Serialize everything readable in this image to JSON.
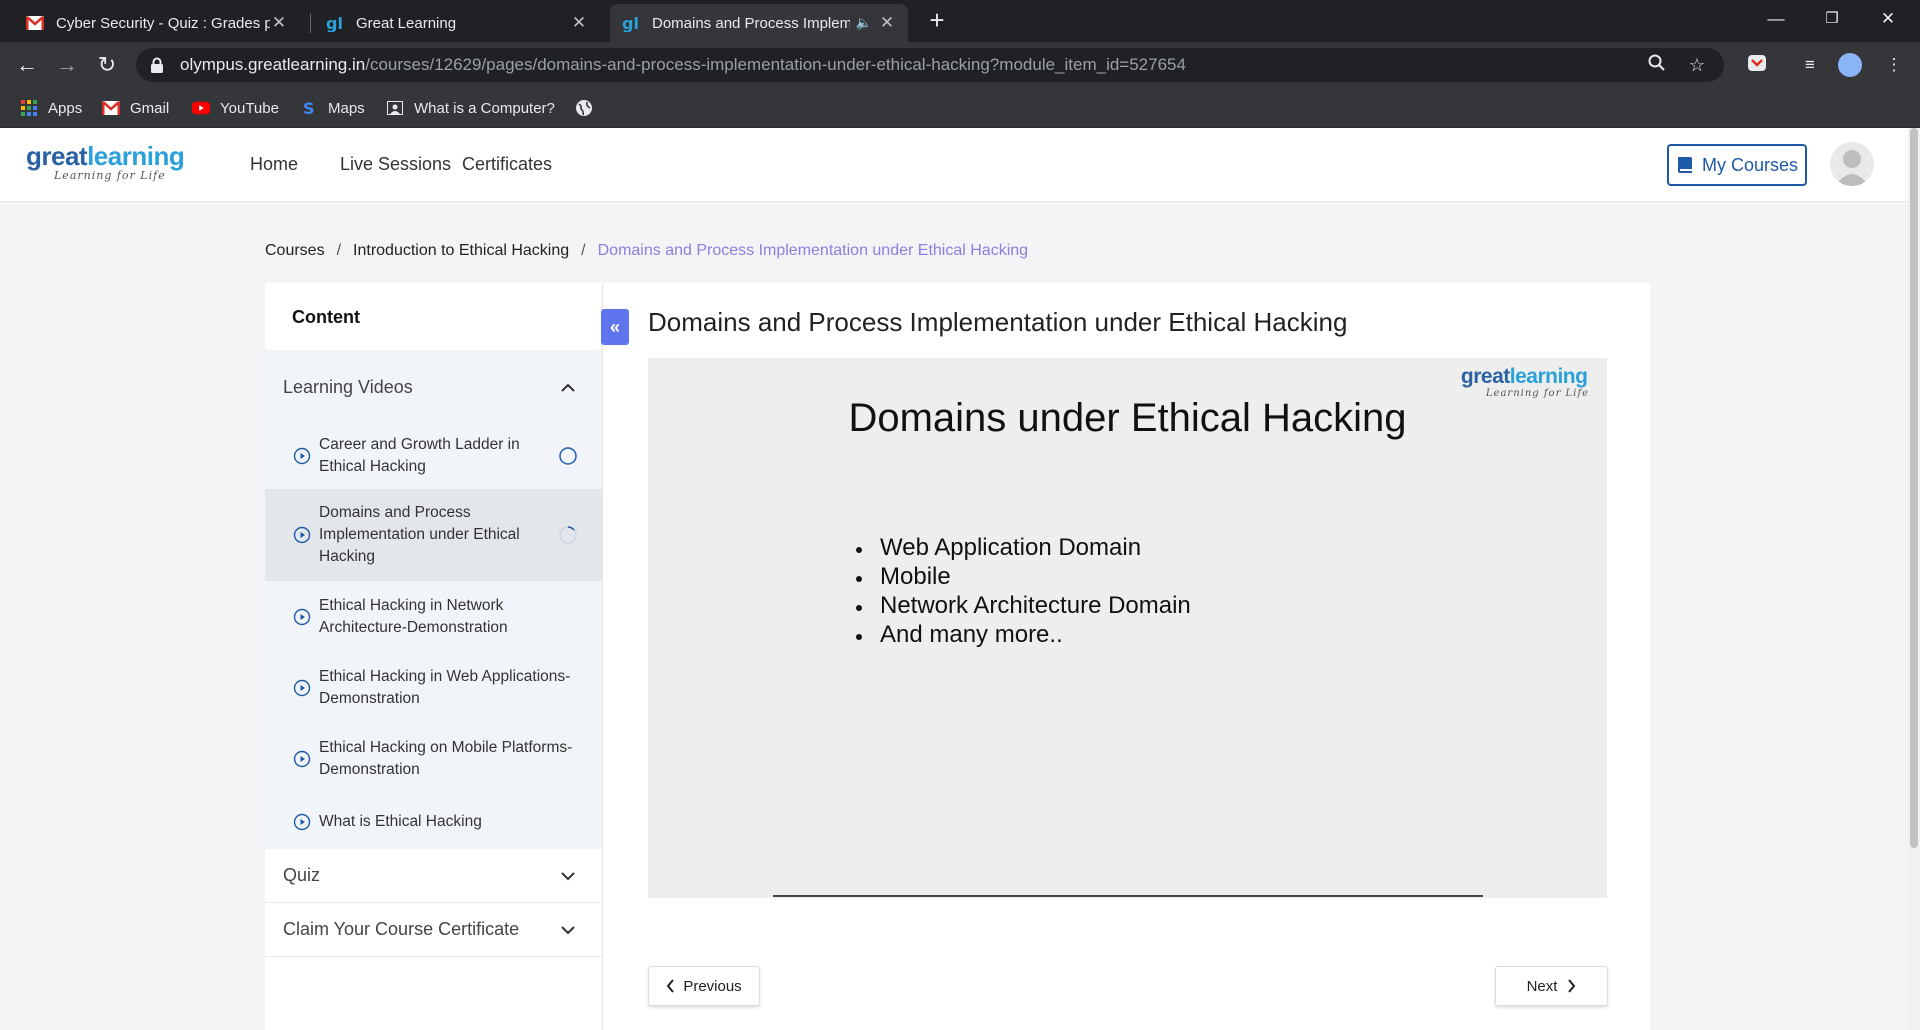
{
  "browser": {
    "tabs": [
      {
        "title": "Cyber Security - Quiz : Grades pu",
        "icon": "gmail-icon"
      },
      {
        "title": "Great Learning",
        "icon": "greatlearning-favicon"
      },
      {
        "title": "Domains and Process Implem",
        "icon": "greatlearning-favicon",
        "active": true,
        "audio": true
      }
    ],
    "url_host": "olympus.greatlearning.in",
    "url_path": "/courses/12629/pages/domains-and-process-implementation-under-ethical-hacking?module_item_id=527654",
    "bookmarks": [
      {
        "label": "Apps",
        "icon": "apps-grid-icon"
      },
      {
        "label": "Gmail",
        "icon": "gmail-icon"
      },
      {
        "label": "YouTube",
        "icon": "youtube-icon"
      },
      {
        "label": "Maps",
        "icon": "maps-icon"
      },
      {
        "label": "What is a Computer?",
        "icon": "page-icon"
      },
      {
        "label": "",
        "icon": "globe-icon"
      }
    ]
  },
  "site": {
    "logo_main_a": "great",
    "logo_main_b": "learning",
    "logo_sub": "Learning for Life",
    "nav": [
      "Home",
      "Live Sessions",
      "Certificates"
    ],
    "my_courses": "My Courses"
  },
  "breadcrumb": {
    "items": [
      "Courses",
      "Introduction to Ethical Hacking"
    ],
    "separator": "/",
    "current": "Domains and Process Implementation under Ethical Hacking"
  },
  "sidebar": {
    "header": "Content",
    "sections": [
      {
        "title": "Learning Videos",
        "expanded": true,
        "items": [
          {
            "label": "Career and Growth Ladder in Ethical Hacking",
            "status": "not-started"
          },
          {
            "label": "Domains and Process Implementation under Ethical Hacking",
            "status": "in-progress",
            "active": true
          },
          {
            "label": "Ethical Hacking in Network Architecture-Demonstration",
            "status": "none"
          },
          {
            "label": "Ethical Hacking in Web Applications-Demonstration",
            "status": "none"
          },
          {
            "label": "Ethical Hacking on Mobile Platforms-Demonstration",
            "status": "none"
          },
          {
            "label": "What is Ethical Hacking",
            "status": "none"
          }
        ]
      },
      {
        "title": "Quiz",
        "expanded": false
      },
      {
        "title": "Claim Your Course Certificate",
        "expanded": false
      }
    ]
  },
  "main": {
    "title": "Domains and Process Implementation under Ethical Hacking",
    "slide": {
      "title": "Domains under Ethical Hacking",
      "bullets": [
        "Web Application Domain",
        "Mobile",
        "Network Architecture Domain",
        "And many more.."
      ]
    },
    "prev_label": "Previous",
    "next_label": "Next"
  },
  "colors": {
    "accent": "#5f75ee",
    "brand_blue": "#2b62a4",
    "brand_light": "#2aa1da",
    "breadcrumb_current": "#8a7fe0",
    "status_ring": "#1e5aa8"
  }
}
